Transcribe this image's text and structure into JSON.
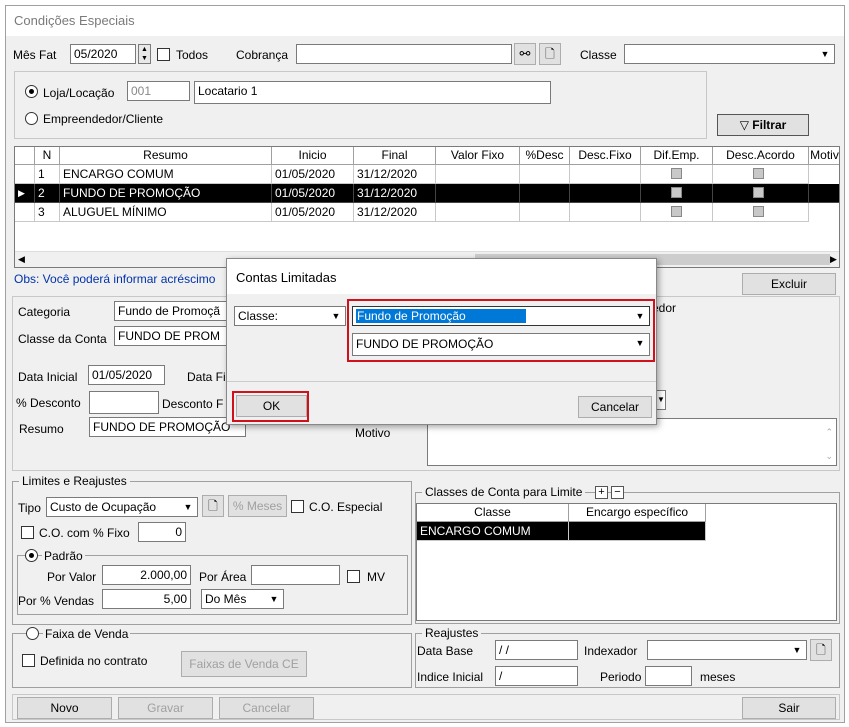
{
  "window": {
    "title": "Condições Especiais"
  },
  "top": {
    "mes_fat_label": "Mês Fat",
    "mes_fat_value": "05/2020",
    "todos_label": "Todos",
    "cobranca_label": "Cobrança",
    "cobranca_value": "",
    "classe_label": "Classe",
    "classe_value": "",
    "loja_label": "Loja/Locação",
    "loja_code": "001",
    "loja_name": "Locatario 1",
    "empreendedor_label": "Empreendedor/Cliente",
    "filtrar_label": "Filtrar"
  },
  "grid": {
    "columns": [
      "N",
      "Resumo",
      "Inicio",
      "Final",
      "Valor Fixo",
      "%Desc",
      "Desc.Fixo",
      "Dif.Emp.",
      "Desc.Acordo",
      "Motiv"
    ],
    "rows": [
      {
        "n": "1",
        "resumo": "ENCARGO COMUM",
        "inicio": "01/05/2020",
        "final": "31/12/2020"
      },
      {
        "n": "2",
        "resumo": "FUNDO DE PROMOÇÃO",
        "inicio": "01/05/2020",
        "final": "31/12/2020"
      },
      {
        "n": "3",
        "resumo": "ALUGUEL MÍNIMO",
        "inicio": "01/05/2020",
        "final": "31/12/2020"
      }
    ]
  },
  "obs": "Obs: Você poderá informar acréscimo",
  "excluir_label": "Excluir",
  "detail": {
    "categoria_label": "Categoria",
    "categoria_value": "Fundo de Promoçã",
    "classe_conta_label": "Classe da Conta",
    "classe_conta_value": "FUNDO DE PROM",
    "data_inicial_label": "Data Inicial",
    "data_inicial_value": "01/05/2020",
    "data_final_label": "Data Fi",
    "desconto_pct_label": "% Desconto",
    "desconto_fixo_label": "Desconto F",
    "resumo_label": "Resumo",
    "resumo_value": "FUNDO DE PROMOÇÃO",
    "motivo_label": "Motivo",
    "edor_label": "edor"
  },
  "limites": {
    "title": "Limites e Reajustes",
    "tipo_label": "Tipo",
    "tipo_value": "Custo de Ocupação",
    "meses_label": "% Meses",
    "co_especial_label": "C.O. Especial",
    "co_fixo_label": "C.O. com % Fixo",
    "co_fixo_value": "0",
    "padrao_label": "Padrão",
    "por_valor_label": "Por Valor",
    "por_valor_value": "2.000,00",
    "por_area_label": "Por Área",
    "mv_label": "MV",
    "por_vendas_label": "Por % Vendas",
    "por_vendas_value": "5,00",
    "periodo_value": "Do Mês",
    "faixa_label": "Faixa de Venda",
    "definida_label": "Definida no contrato",
    "faixas_btn": "Faixas de Venda CE"
  },
  "classes_limite": {
    "title": "Classes de Conta para Limite",
    "col_classe": "Classe",
    "col_encargo": "Encargo específico",
    "rows": [
      {
        "classe": "ENCARGO COMUM",
        "encargo": ""
      }
    ]
  },
  "reajustes": {
    "title": "Reajustes",
    "data_base_label": "Data Base",
    "data_base_value": " / /",
    "indexador_label": "Indexador",
    "indice_label": "Indice Inicial",
    "indice_value": " /",
    "periodo_label": "Periodo",
    "meses_label": "meses"
  },
  "bottom": {
    "novo": "Novo",
    "gravar": "Gravar",
    "cancelar": "Cancelar",
    "sair": "Sair"
  },
  "dialog": {
    "title": "Contas Limitadas",
    "classe_select": "Classe:",
    "categoria_value": "Fundo de Promoção",
    "conta_value": "FUNDO DE PROMOÇÃO",
    "ok": "OK",
    "cancelar": "Cancelar"
  },
  "colors": {
    "highlight": "#d0101a",
    "selection": "#0078d7"
  }
}
